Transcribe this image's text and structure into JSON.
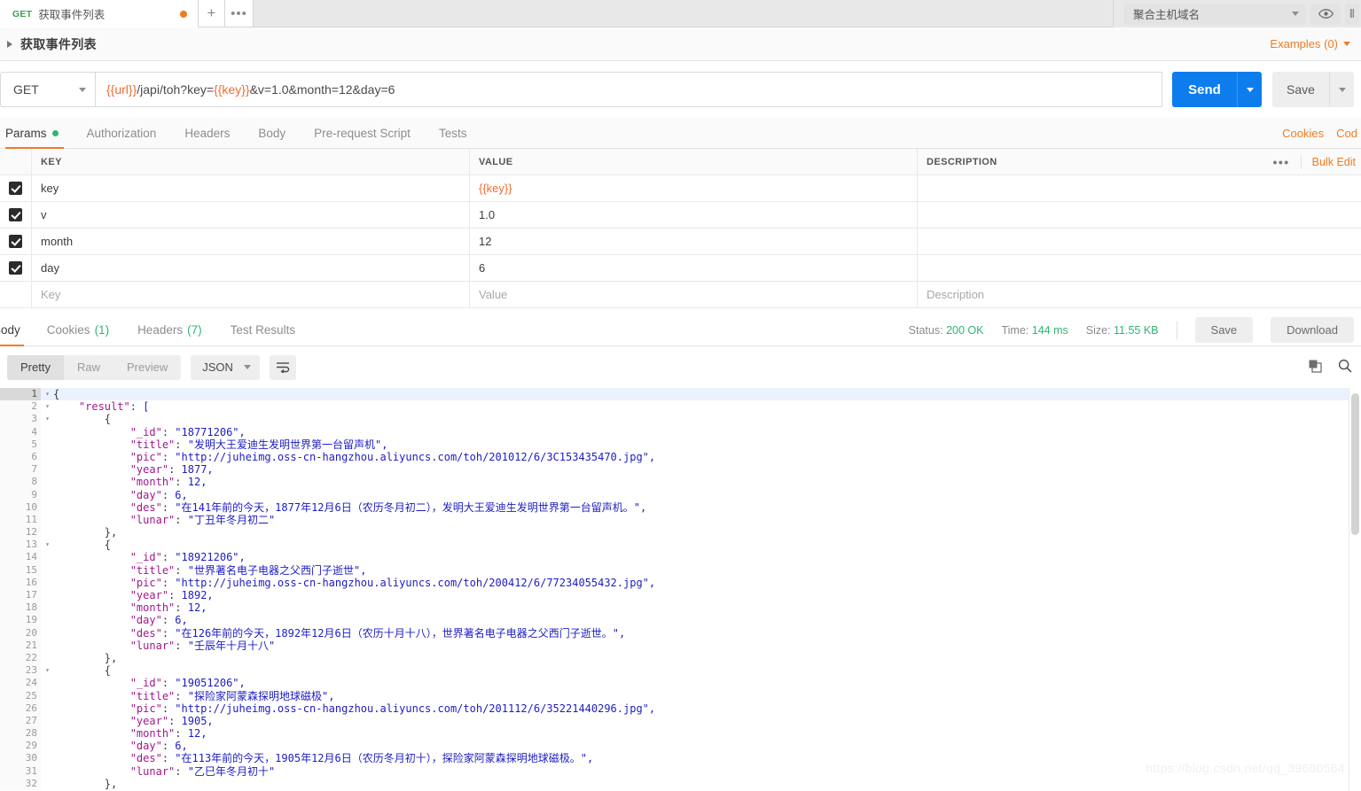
{
  "tab": {
    "method": "GET",
    "name": "获取事件列表",
    "unsaved_dot": "unsaved",
    "plus_label": "+",
    "more_label": "•••"
  },
  "environment": {
    "selected": "聚合主机域名",
    "eye_icon": "eye-icon"
  },
  "request_header": {
    "title": "获取事件列表",
    "examples": "Examples (0)"
  },
  "url_bar": {
    "method": "GET",
    "url_prefix_var": "{{url}}",
    "url_mid": "/japi/toh?key=",
    "url_key_var": "{{key}}",
    "url_suffix": "&v=1.0&month=12&day=6",
    "send_label": "Send",
    "save_label": "Save"
  },
  "request_tabs": {
    "items": [
      {
        "label": "Params",
        "dot": true,
        "active": true
      },
      {
        "label": "Authorization",
        "dot": false,
        "active": false
      },
      {
        "label": "Headers",
        "dot": false,
        "active": false
      },
      {
        "label": "Body",
        "dot": false,
        "active": false
      },
      {
        "label": "Pre-request Script",
        "dot": false,
        "active": false
      },
      {
        "label": "Tests",
        "dot": false,
        "active": false
      }
    ],
    "cookies_link": "Cookies",
    "code_link": "Cod"
  },
  "params_table": {
    "headers": {
      "key": "KEY",
      "value": "VALUE",
      "description": "DESCRIPTION"
    },
    "dots": "•••",
    "bulk_edit": "Bulk Edit",
    "rows": [
      {
        "checked": true,
        "key": "key",
        "value": "{{key}}",
        "value_is_var": true,
        "description": ""
      },
      {
        "checked": true,
        "key": "v",
        "value": "1.0",
        "value_is_var": false,
        "description": ""
      },
      {
        "checked": true,
        "key": "month",
        "value": "12",
        "value_is_var": false,
        "description": ""
      },
      {
        "checked": true,
        "key": "day",
        "value": "6",
        "value_is_var": false,
        "description": ""
      }
    ],
    "placeholder_row": {
      "key": "Key",
      "value": "Value",
      "description": "Description"
    }
  },
  "response": {
    "tabs": [
      {
        "label": "Body",
        "count": "",
        "active": true
      },
      {
        "label": "Cookies",
        "count": "(1)",
        "active": false
      },
      {
        "label": "Headers",
        "count": "(7)",
        "active": false
      },
      {
        "label": "Test Results",
        "count": "",
        "active": false
      }
    ],
    "status_label": "Status:",
    "status_value": "200 OK",
    "time_label": "Time:",
    "time_value": "144 ms",
    "size_label": "Size:",
    "size_value": "11.55 KB",
    "save_label": "Save",
    "download_label": "Download",
    "view_modes": [
      {
        "label": "Pretty",
        "active": true
      },
      {
        "label": "Raw",
        "active": false
      },
      {
        "label": "Preview",
        "active": false
      }
    ],
    "format": "JSON",
    "wrap_icon": "wrap-lines-icon",
    "copy_icon": "copy-icon",
    "search_icon": "search-icon"
  },
  "code": {
    "lines": [
      {
        "n": "1",
        "fold": "▾",
        "text": "{",
        "hl": true
      },
      {
        "n": "2",
        "fold": "▾",
        "text": "    \"result\": [",
        "hl": false
      },
      {
        "n": "3",
        "fold": "▾",
        "text": "        {",
        "hl": false
      },
      {
        "n": "4",
        "fold": "",
        "text": "            \"_id\": \"18771206\",",
        "hl": false
      },
      {
        "n": "5",
        "fold": "",
        "text": "            \"title\": \"发明大王爱迪生发明世界第一台留声机\",",
        "hl": false
      },
      {
        "n": "6",
        "fold": "",
        "text": "            \"pic\": \"http://juheimg.oss-cn-hangzhou.aliyuncs.com/toh/201012/6/3C153435470.jpg\",",
        "hl": false
      },
      {
        "n": "7",
        "fold": "",
        "text": "            \"year\": 1877,",
        "hl": false
      },
      {
        "n": "8",
        "fold": "",
        "text": "            \"month\": 12,",
        "hl": false
      },
      {
        "n": "9",
        "fold": "",
        "text": "            \"day\": 6,",
        "hl": false
      },
      {
        "n": "10",
        "fold": "",
        "text": "            \"des\": \"在141年前的今天，1877年12月6日（农历冬月初二），发明大王爱迪生发明世界第一台留声机。\",",
        "hl": false
      },
      {
        "n": "11",
        "fold": "",
        "text": "            \"lunar\": \"丁丑年冬月初二\"",
        "hl": false
      },
      {
        "n": "12",
        "fold": "",
        "text": "        },",
        "hl": false
      },
      {
        "n": "13",
        "fold": "▾",
        "text": "        {",
        "hl": false
      },
      {
        "n": "14",
        "fold": "",
        "text": "            \"_id\": \"18921206\",",
        "hl": false
      },
      {
        "n": "15",
        "fold": "",
        "text": "            \"title\": \"世界著名电子电器之父西门子逝世\",",
        "hl": false
      },
      {
        "n": "16",
        "fold": "",
        "text": "            \"pic\": \"http://juheimg.oss-cn-hangzhou.aliyuncs.com/toh/200412/6/77234055432.jpg\",",
        "hl": false
      },
      {
        "n": "17",
        "fold": "",
        "text": "            \"year\": 1892,",
        "hl": false
      },
      {
        "n": "18",
        "fold": "",
        "text": "            \"month\": 12,",
        "hl": false
      },
      {
        "n": "19",
        "fold": "",
        "text": "            \"day\": 6,",
        "hl": false
      },
      {
        "n": "20",
        "fold": "",
        "text": "            \"des\": \"在126年前的今天，1892年12月6日（农历十月十八），世界著名电子电器之父西门子逝世。\",",
        "hl": false
      },
      {
        "n": "21",
        "fold": "",
        "text": "            \"lunar\": \"壬辰年十月十八\"",
        "hl": false
      },
      {
        "n": "22",
        "fold": "",
        "text": "        },",
        "hl": false
      },
      {
        "n": "23",
        "fold": "▾",
        "text": "        {",
        "hl": false
      },
      {
        "n": "24",
        "fold": "",
        "text": "            \"_id\": \"19051206\",",
        "hl": false
      },
      {
        "n": "25",
        "fold": "",
        "text": "            \"title\": \"探险家阿蒙森探明地球磁极\",",
        "hl": false
      },
      {
        "n": "26",
        "fold": "",
        "text": "            \"pic\": \"http://juheimg.oss-cn-hangzhou.aliyuncs.com/toh/201112/6/35221440296.jpg\",",
        "hl": false
      },
      {
        "n": "27",
        "fold": "",
        "text": "            \"year\": 1905,",
        "hl": false
      },
      {
        "n": "28",
        "fold": "",
        "text": "            \"month\": 12,",
        "hl": false
      },
      {
        "n": "29",
        "fold": "",
        "text": "            \"day\": 6,",
        "hl": false
      },
      {
        "n": "30",
        "fold": "",
        "text": "            \"des\": \"在113年前的今天，1905年12月6日（农历冬月初十），探险家阿蒙森探明地球磁极。\",",
        "hl": false
      },
      {
        "n": "31",
        "fold": "",
        "text": "            \"lunar\": \"乙巳年冬月初十\"",
        "hl": false
      },
      {
        "n": "32",
        "fold": "",
        "text": "        },",
        "hl": false
      }
    ]
  },
  "watermark": "https://blog.csdn.net/qq_39680564",
  "colors": {
    "accent_orange": "#ef7b22",
    "send_blue": "#0d7ded",
    "status_green": "#2fb673",
    "method_green": "#3fa04a",
    "json_string": "#1a1aca",
    "json_key": "#a3178e"
  }
}
